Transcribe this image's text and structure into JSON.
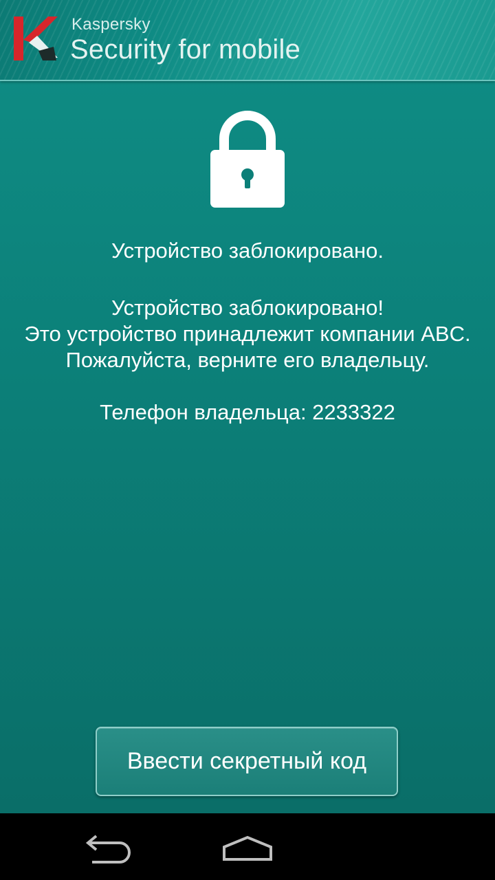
{
  "header": {
    "brand_small": "Kaspersky",
    "brand_title": "Security for mobile"
  },
  "lock_icon": "lock-icon",
  "messages": {
    "status": "Устройство заблокировано.",
    "body": "Устройство заблокировано!\nЭто устройство принадлежит компании ABC.\nПожалуйста, верните его владельцу.",
    "phone": "Телефон владельца: 2233322"
  },
  "button": {
    "label": "Ввести секретный код"
  },
  "navbar": {
    "back_icon": "back-icon",
    "home_icon": "home-icon"
  },
  "colors": {
    "background": "#0c8079",
    "header": "#0e8a83",
    "logo_red": "#d7262b",
    "text": "#ffffff",
    "navbar": "#000000"
  }
}
